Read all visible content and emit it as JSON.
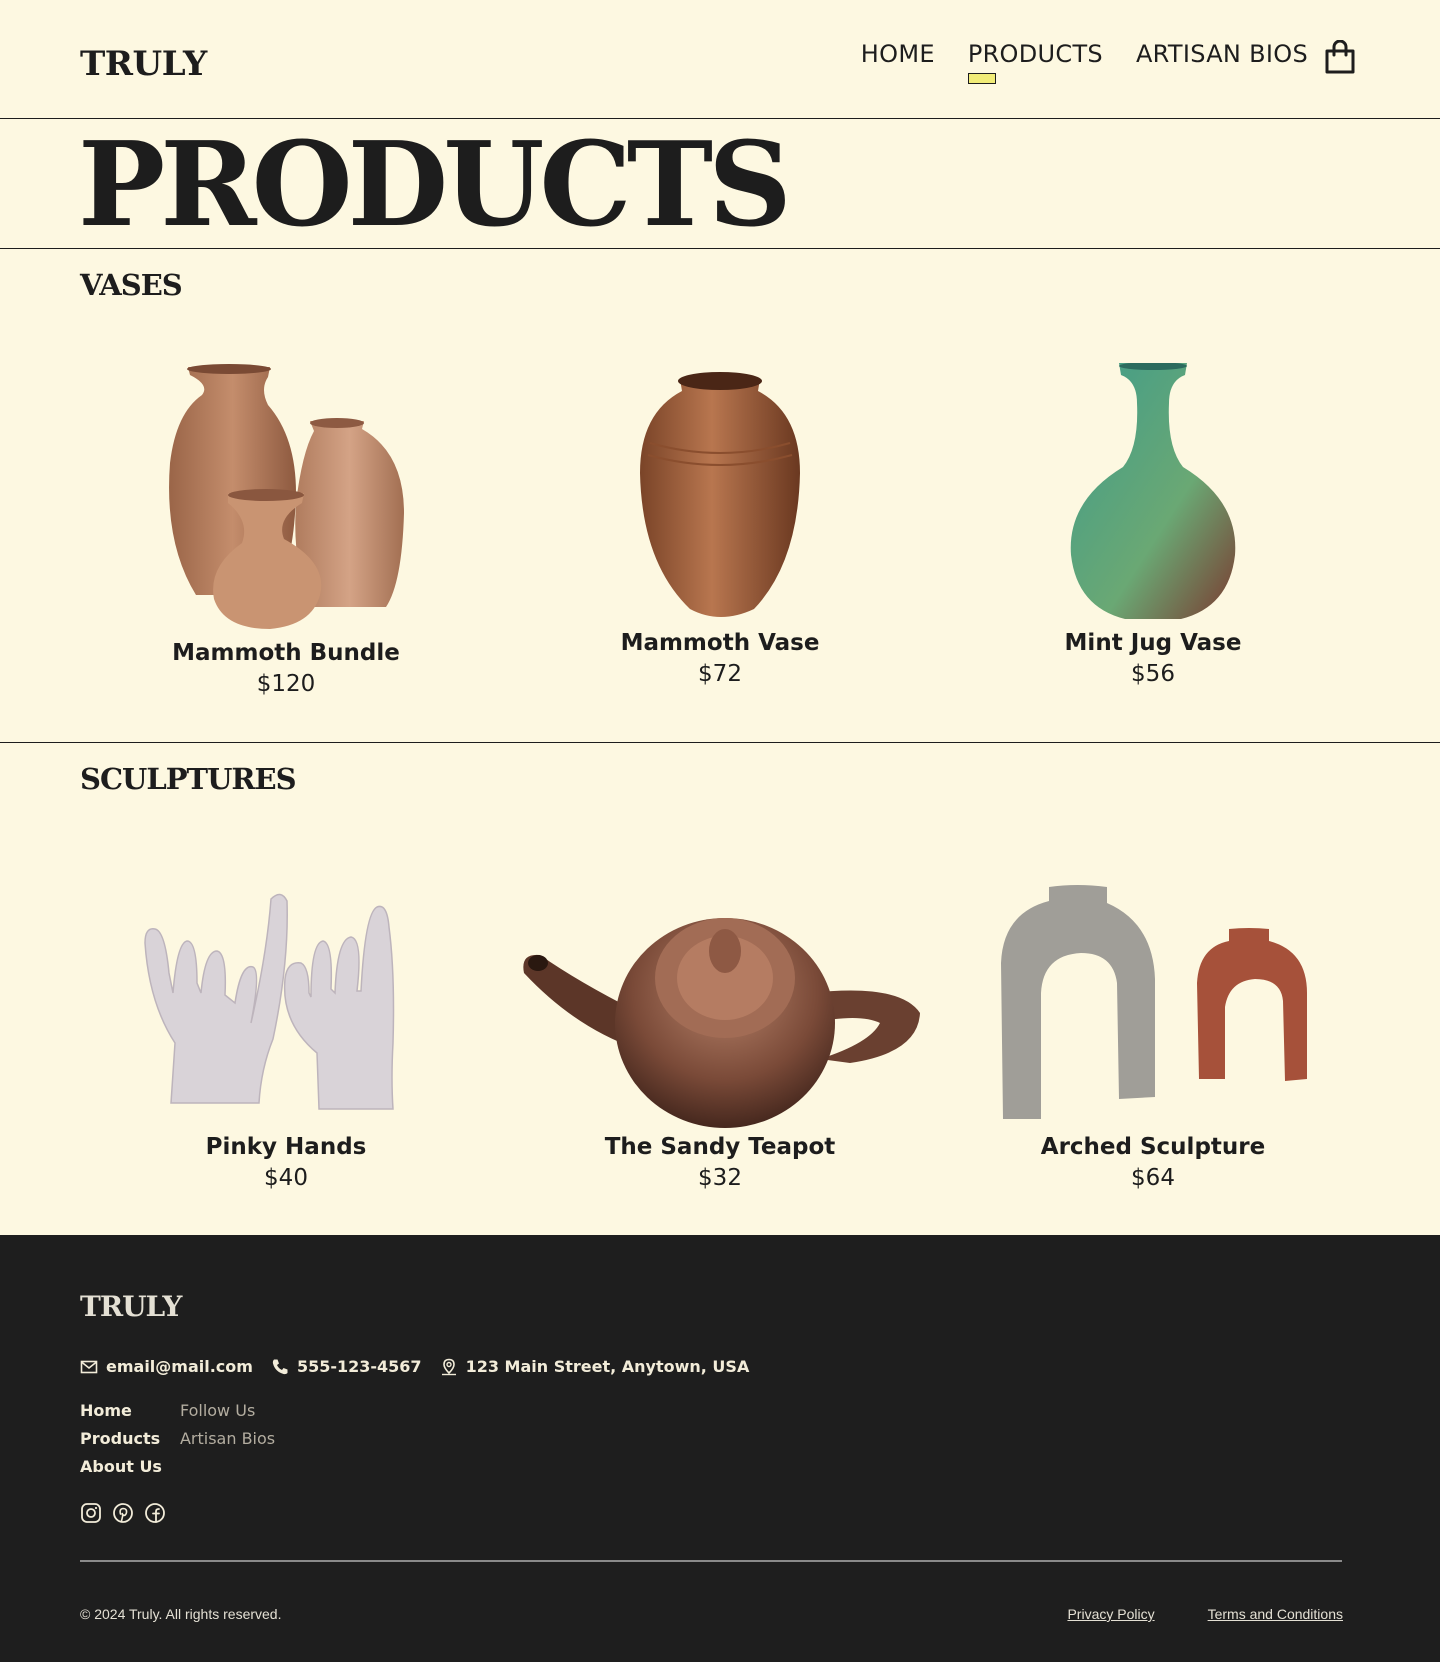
{
  "header": {
    "logo": "TRULY",
    "nav": [
      {
        "label": "HOME"
      },
      {
        "label": "PRODUCTS"
      },
      {
        "label": "ARTISAN BIOS"
      }
    ],
    "cart_icon": "shopping-bag-icon",
    "accent_color": "#f1ec77"
  },
  "page": {
    "title": "PRODUCTS"
  },
  "sections": [
    {
      "title": "VASES",
      "products": [
        {
          "name": "Mammoth Bundle",
          "price": "$120"
        },
        {
          "name": "Mammoth Vase",
          "price": "$72"
        },
        {
          "name": "Mint Jug Vase",
          "price": "$56"
        }
      ]
    },
    {
      "title": "SCULPTURES",
      "products": [
        {
          "name": "Pinky Hands",
          "price": "$40"
        },
        {
          "name": "The Sandy Teapot",
          "price": "$32"
        },
        {
          "name": "Arched Sculpture",
          "price": "$64"
        }
      ]
    }
  ],
  "footer": {
    "logo": "TRULY",
    "email": "email@mail.com",
    "phone": "555-123-4567",
    "address": "123 Main Street, Anytown, USA",
    "links_primary": [
      "Home",
      "Products",
      "About Us"
    ],
    "links_secondary": [
      "Follow Us",
      "Artisan Bios"
    ],
    "social_icons": [
      "instagram-icon",
      "pinterest-icon",
      "facebook-icon"
    ],
    "copyright": "© 2024 Truly. All rights reserved.",
    "privacy": "Privacy Policy",
    "terms": "Terms and Conditions"
  },
  "colors": {
    "background": "#fdf8e1",
    "footer_background": "#1e1e1e",
    "text": "#1d1d1d"
  }
}
